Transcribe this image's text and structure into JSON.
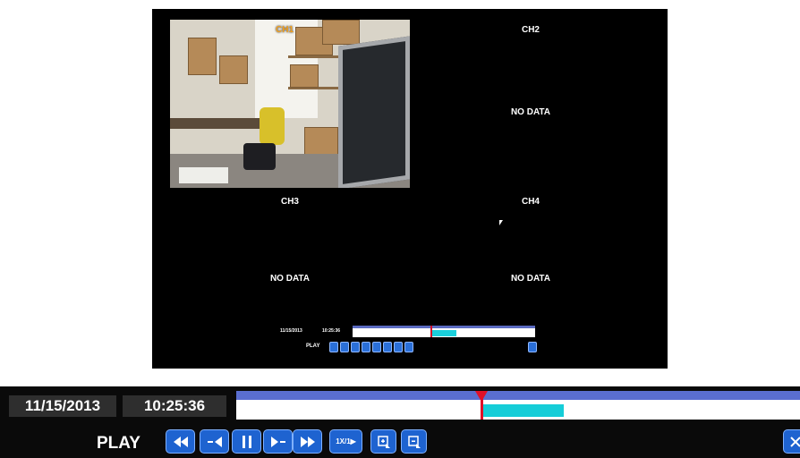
{
  "monitor": {
    "channels": [
      {
        "label": "CH1",
        "status": ""
      },
      {
        "label": "CH2",
        "status": "NO DATA"
      },
      {
        "label": "CH3",
        "status": "NO DATA"
      },
      {
        "label": "CH4",
        "status": "NO DATA"
      }
    ],
    "mini_bar": {
      "date": "11/15/2013",
      "time": "10:25:36",
      "play_label": "PLAY"
    }
  },
  "playback": {
    "date": "11/15/2013",
    "time": "10:25:36",
    "play_label": "PLAY",
    "speed_label": "1X/1▶",
    "buttons": [
      "rewind-icon",
      "step-back-icon",
      "pause-icon",
      "step-forward-icon",
      "fast-forward-icon",
      "speed-icon",
      "zoom-in-icon",
      "zoom-out-icon",
      "close-icon"
    ]
  },
  "colors": {
    "accent_button": "#1e63d0",
    "timeline_recorded": "#15cdd8",
    "timeline_header": "#5a6ed0",
    "playhead": "#e01028",
    "ch1_label": "#f0a020"
  }
}
